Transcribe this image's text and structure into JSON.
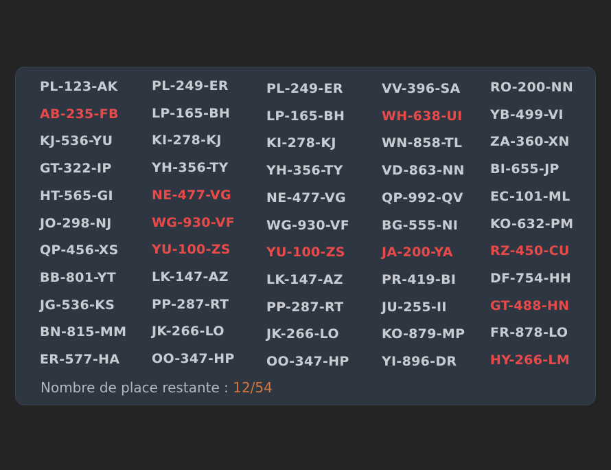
{
  "columns": [
    [
      {
        "plate": "PL-123-AK",
        "taken": false
      },
      {
        "plate": "AB-235-FB",
        "taken": true
      },
      {
        "plate": "KJ-536-YU",
        "taken": false
      },
      {
        "plate": "GT-322-IP",
        "taken": false
      },
      {
        "plate": "HT-565-GI",
        "taken": false
      },
      {
        "plate": "JO-298-NJ",
        "taken": false
      },
      {
        "plate": "QP-456-XS",
        "taken": false
      },
      {
        "plate": "BB-801-YT",
        "taken": false
      },
      {
        "plate": "JG-536-KS",
        "taken": false
      },
      {
        "plate": "BN-815-MM",
        "taken": false
      },
      {
        "plate": "ER-577-HA",
        "taken": false
      }
    ],
    [
      {
        "plate": "PL-249-ER",
        "taken": false
      },
      {
        "plate": "LP-165-BH",
        "taken": false
      },
      {
        "plate": "KI-278-KJ",
        "taken": false
      },
      {
        "plate": "YH-356-TY",
        "taken": false
      },
      {
        "plate": "NE-477-VG",
        "taken": true
      },
      {
        "plate": "WG-930-VF",
        "taken": true
      },
      {
        "plate": "YU-100-ZS",
        "taken": true
      },
      {
        "plate": "LK-147-AZ",
        "taken": false
      },
      {
        "plate": "PP-287-RT",
        "taken": false
      },
      {
        "plate": "JK-266-LO",
        "taken": false
      },
      {
        "plate": "OO-347-HP",
        "taken": false
      }
    ],
    [
      {
        "plate": "PL-249-ER",
        "taken": false
      },
      {
        "plate": "LP-165-BH",
        "taken": false
      },
      {
        "plate": "KI-278-KJ",
        "taken": false
      },
      {
        "plate": "YH-356-TY",
        "taken": false
      },
      {
        "plate": "NE-477-VG",
        "taken": false
      },
      {
        "plate": "WG-930-VF",
        "taken": false
      },
      {
        "plate": "YU-100-ZS",
        "taken": true
      },
      {
        "plate": "LK-147-AZ",
        "taken": false
      },
      {
        "plate": "PP-287-RT",
        "taken": false
      },
      {
        "plate": "JK-266-LO",
        "taken": false
      },
      {
        "plate": "OO-347-HP",
        "taken": false
      }
    ],
    [
      {
        "plate": "VV-396-SA",
        "taken": false
      },
      {
        "plate": "WH-638-UI",
        "taken": true
      },
      {
        "plate": "WN-858-TL",
        "taken": false
      },
      {
        "plate": "VD-863-NN",
        "taken": false
      },
      {
        "plate": "QP-992-QV",
        "taken": false
      },
      {
        "plate": "BG-555-NI",
        "taken": false
      },
      {
        "plate": "JA-200-YA",
        "taken": true
      },
      {
        "plate": "PR-419-BI",
        "taken": false
      },
      {
        "plate": "JU-255-II",
        "taken": false
      },
      {
        "plate": "KO-879-MP",
        "taken": false
      },
      {
        "plate": "YI-896-DR",
        "taken": false
      }
    ],
    [
      {
        "plate": "RO-200-NN",
        "taken": false
      },
      {
        "plate": "YB-499-VI",
        "taken": false
      },
      {
        "plate": "ZA-360-XN",
        "taken": false
      },
      {
        "plate": "BI-655-JP",
        "taken": false
      },
      {
        "plate": "EC-101-ML",
        "taken": false
      },
      {
        "plate": "KO-632-PM",
        "taken": false
      },
      {
        "plate": "RZ-450-CU",
        "taken": true
      },
      {
        "plate": "DF-754-HH",
        "taken": false
      },
      {
        "plate": "GT-488-HN",
        "taken": true
      },
      {
        "plate": "FR-878-LO",
        "taken": false
      },
      {
        "plate": "HY-266-LM",
        "taken": true
      }
    ]
  ],
  "footer": {
    "label": "Nombre de place restante : ",
    "count": "12/54"
  },
  "colors": {
    "background": "#242424",
    "panel": "#2e3741",
    "plate_free": "#c8ccd2",
    "plate_taken": "#e84a4a",
    "count_accent": "#d6763d"
  }
}
